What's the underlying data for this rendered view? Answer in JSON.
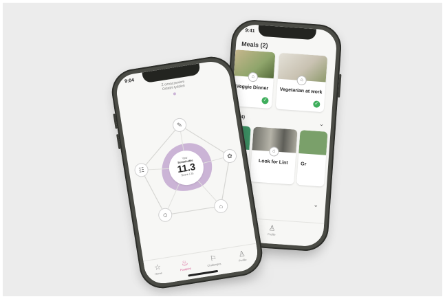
{
  "back_phone": {
    "time": "9:41",
    "section_title": "Meals (2)",
    "cards": [
      {
        "label": "Veggie Dinner",
        "img_color": "#b9c7a4"
      },
      {
        "label": "Vegetarian at work",
        "img_color": "#d9d4c9"
      }
    ],
    "section2_title": "(4/4)",
    "row2_cards": [
      {
        "label": "",
        "img_color": "#3c8f63"
      },
      {
        "label": "Look for Lint",
        "img_color": "#9a9a90"
      },
      {
        "label": "Gr",
        "img_color": "#7aa06a"
      }
    ],
    "nav_items": [
      {
        "icon": "▭",
        "label": ""
      },
      {
        "icon": "♙",
        "label": "Profile"
      }
    ]
  },
  "front_phone": {
    "time": "9:04",
    "header_line1": "Z oznaczeniem",
    "header_line2": "Ostatni tydzień",
    "center": {
      "caption_top": "Your",
      "caption_mid": "Sustainable",
      "score": "11.3",
      "caption_bottom": "Score / 25"
    },
    "nodes": [
      {
        "name": "node-top",
        "icon": "✎"
      },
      {
        "name": "node-right",
        "icon": "✿"
      },
      {
        "name": "node-bottom-right",
        "icon": "⌂"
      },
      {
        "name": "node-bottom-left",
        "icon": "☺"
      },
      {
        "name": "node-left",
        "icon": "☷"
      }
    ],
    "nav": [
      {
        "icon": "☆",
        "label": "Home"
      },
      {
        "icon": "♨",
        "label": "Footprint"
      },
      {
        "icon": "⚐",
        "label": "Challenges"
      },
      {
        "icon": "♙",
        "label": "Profile"
      }
    ]
  },
  "colors": {
    "accent": "#d44d8a",
    "blob": "#cbb4d6",
    "check": "#3fae5c",
    "frame": "#4a4b45",
    "background": "#ececec"
  }
}
